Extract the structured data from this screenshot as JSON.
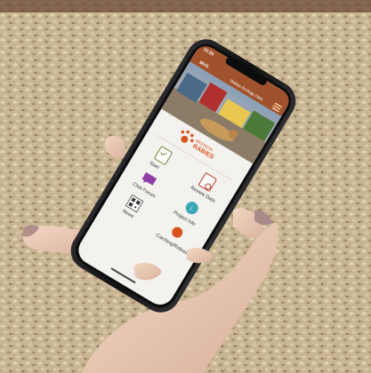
{
  "status_bar": {
    "time": "12:25"
  },
  "header": {
    "brand": "MVS",
    "title": "Rabies Ecology Data"
  },
  "logo": {
    "line1": "MISSION",
    "line2": "RABIES"
  },
  "menu": [
    {
      "label": "Start",
      "icon": "checklist-icon"
    },
    {
      "label": "Review Data",
      "icon": "review-icon"
    },
    {
      "label": "Chat Forum",
      "icon": "chat-icon"
    },
    {
      "label": "News",
      "icon": "qr-code-icon"
    },
    {
      "label": "Project Info",
      "icon": "info-icon"
    },
    {
      "label": "Catching/Release",
      "icon": "location-pin-icon"
    }
  ],
  "colors": {
    "header_bg": "#a0522d",
    "accent_orange": "#d9531e",
    "chat_purple": "#8e3fa6",
    "info_teal": "#3aa6b9",
    "phone_frame": "#1b1b1d"
  }
}
